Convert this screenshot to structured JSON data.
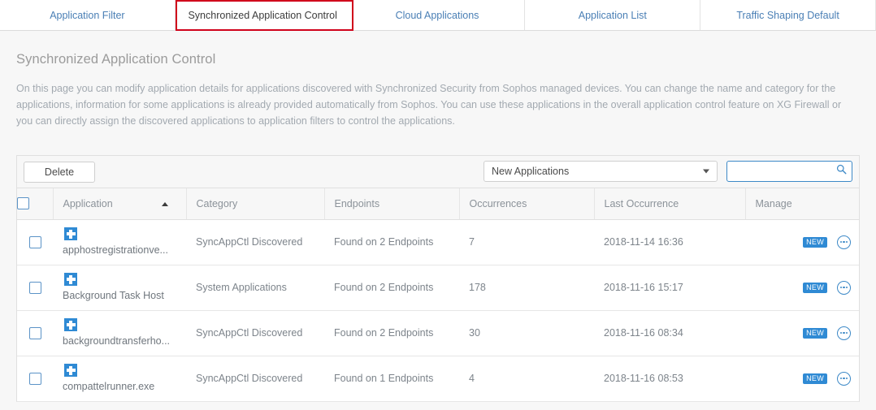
{
  "tabs": [
    {
      "label": "Application Filter",
      "active": false
    },
    {
      "label": "Synchronized Application Control",
      "active": true
    },
    {
      "label": "Cloud Applications",
      "active": false
    },
    {
      "label": "Application List",
      "active": false
    },
    {
      "label": "Traffic Shaping Default",
      "active": false
    }
  ],
  "page": {
    "title": "Synchronized Application Control",
    "description": "On this page you can modify application details for applications discovered with Synchronized Security from Sophos managed devices. You can change the name and category for the applications, information for some applications is already provided automatically from Sophos. You can use these applications in the overall application control feature on XG Firewall or you can directly assign the discovered applications to application filters to control the applications."
  },
  "toolbar": {
    "delete_label": "Delete",
    "filter_value": "New Applications",
    "search_value": "",
    "search_placeholder": "",
    "search_icon": "search-icon",
    "caret_icon": "chevron-down-icon"
  },
  "table": {
    "columns": [
      "Application",
      "Category",
      "Endpoints",
      "Occurrences",
      "Last Occurrence",
      "Manage"
    ],
    "sort": {
      "column": "Application",
      "direction": "asc"
    },
    "rows": [
      {
        "application": "apphostregistrationve...",
        "category": "SyncAppCtl Discovered",
        "endpoints": "Found on 2 Endpoints",
        "occurrences": "7",
        "last_occurrence": "2018-11-14 16:36",
        "badge": "NEW"
      },
      {
        "application": "Background Task Host",
        "category": "System Applications",
        "endpoints": "Found on 2 Endpoints",
        "occurrences": "178",
        "last_occurrence": "2018-11-16 15:17",
        "badge": "NEW"
      },
      {
        "application": "backgroundtransferho...",
        "category": "SyncAppCtl Discovered",
        "endpoints": "Found on 2 Endpoints",
        "occurrences": "30",
        "last_occurrence": "2018-11-16 08:34",
        "badge": "NEW"
      },
      {
        "application": "compattelrunner.exe",
        "category": "SyncAppCtl Discovered",
        "endpoints": "Found on 1 Endpoints",
        "occurrences": "4",
        "last_occurrence": "2018-11-16 08:53",
        "badge": "NEW"
      }
    ]
  },
  "colors": {
    "accent": "#3d89c7",
    "icon_blue": "#2f8ad4",
    "highlight": "#d0021b",
    "tab_link": "#4a7fb5"
  }
}
